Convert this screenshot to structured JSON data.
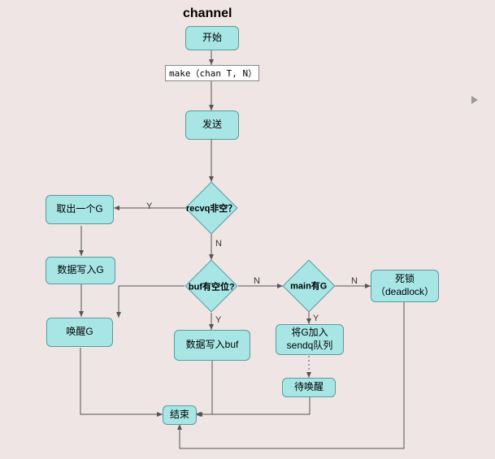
{
  "title": "channel",
  "nodes": {
    "start": "开始",
    "make": "make（chan T, N）",
    "send": "发送",
    "recvq": "recvq非空？",
    "takeG": "取出一个G",
    "writeG": "数据写入G",
    "wakeG": "唤醒G",
    "bufHas": "buf有空位?",
    "writeBuf": "数据写入buf",
    "mainG": "main有G",
    "joinSendq": "将G加入sendq队列",
    "waitWake": "待唤醒",
    "deadlock": "死锁（deadlock）",
    "end": "结束"
  },
  "labels": {
    "yes": "Y",
    "no": "N"
  }
}
